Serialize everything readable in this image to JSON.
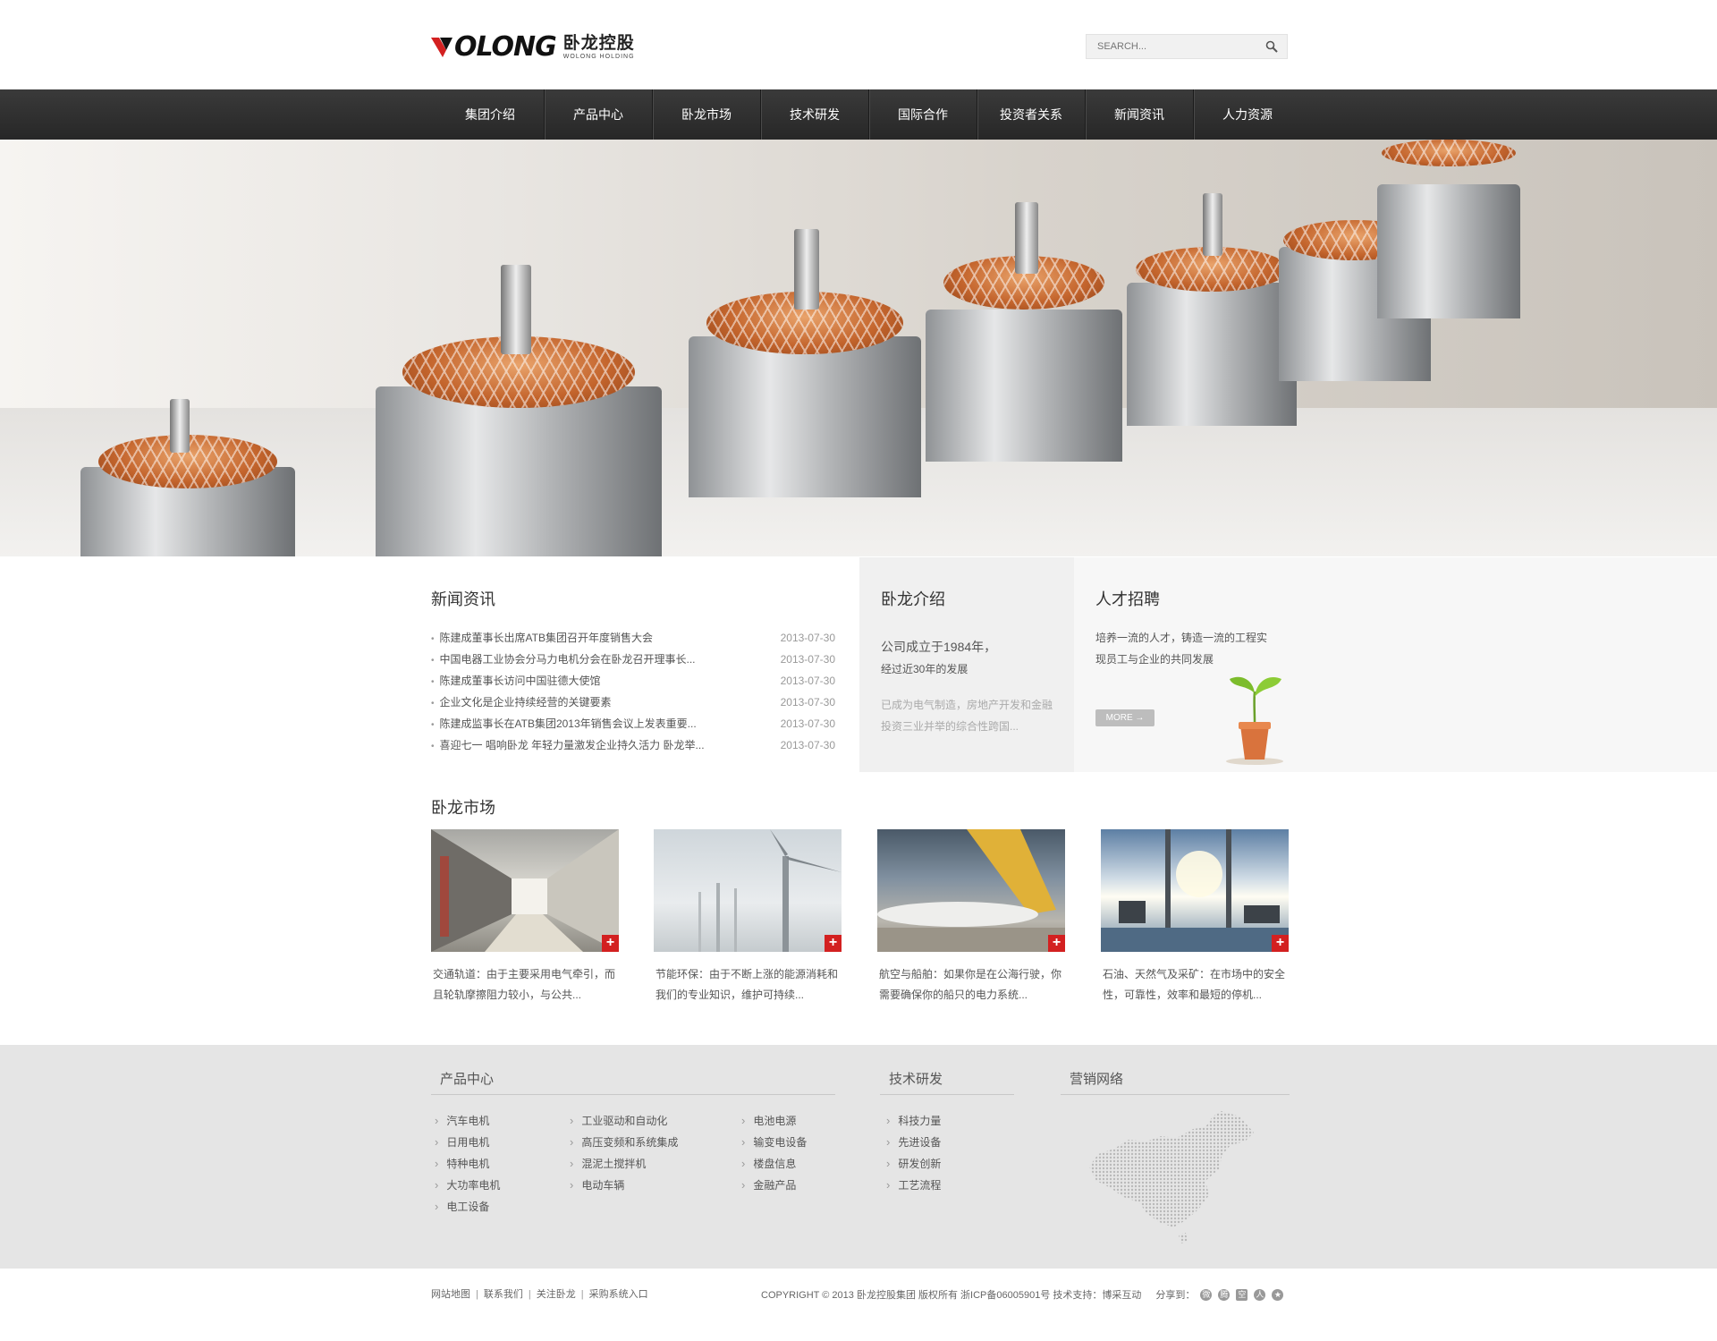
{
  "header": {
    "logo_text": "OLONG",
    "logo_cn": "卧龙控股",
    "logo_en": "WOLONG HOLDING",
    "search_placeholder": "SEARCH..."
  },
  "nav": [
    "集团介绍",
    "产品中心",
    "卧龙市场",
    "技术研发",
    "国际合作",
    "投资者关系",
    "新闻资讯",
    "人力资源"
  ],
  "news": {
    "title": "新闻资讯",
    "items": [
      {
        "text": "陈建成董事长出席ATB集团召开年度销售大会",
        "date": "2013-07-30"
      },
      {
        "text": "中国电器工业协会分马力电机分会在卧龙召开理事长...",
        "date": "2013-07-30"
      },
      {
        "text": "陈建成董事长访问中国驻德大使馆",
        "date": "2013-07-30"
      },
      {
        "text": "企业文化是企业持续经营的关键要素",
        "date": "2013-07-30"
      },
      {
        "text": "陈建成监事长在ATB集团2013年销售会议上发表重要...",
        "date": "2013-07-30"
      },
      {
        "text": "喜迎七一 唱响卧龙 年轻力量激发企业持久活力 卧龙举...",
        "date": "2013-07-30"
      }
    ]
  },
  "about": {
    "title": "卧龙介绍",
    "line1": "公司成立于1984年，",
    "line2": "经过近30年的发展",
    "line3": "已成为电气制造，房地产开发和金融投资三业并举的综合性跨国..."
  },
  "recruit": {
    "title": "人才招聘",
    "text": "培养一流的人才，铸造一流的工程实现员工与企业的共同发展",
    "more": "MORE →"
  },
  "market": {
    "title": "卧龙市场",
    "cards": [
      {
        "desc": "交通轨道：由于主要采用电气牵引，而且轮轨摩擦阻力较小，与公共..."
      },
      {
        "desc": "节能环保：由于不断上涨的能源消耗和我们的专业知识，维护可持续..."
      },
      {
        "desc": "航空与船舶：如果你是在公海行驶，你需要确保你的船只的电力系统..."
      },
      {
        "desc": "石油、天然气及采矿：在市场中的安全性，可靠性，效率和最短的停机..."
      }
    ],
    "plus": "+"
  },
  "footer": {
    "products_title": "产品中心",
    "products_col1": [
      "汽车电机",
      "日用电机",
      "特种电机",
      "大功率电机",
      "电工设备"
    ],
    "products_col2": [
      "工业驱动和自动化",
      "高压变频和系统集成",
      "混泥土搅拌机",
      "电动车辆"
    ],
    "products_col3": [
      "电池电源",
      "输变电设备",
      "楼盘信息",
      "金融产品"
    ],
    "tech_title": "技术研发",
    "tech_items": [
      "科技力量",
      "先进设备",
      "研发创新",
      "工艺流程"
    ],
    "network_title": "营销网络"
  },
  "bottom": {
    "links": [
      "网站地图",
      "联系我们",
      "关注卧龙",
      "采购系统入口"
    ],
    "copyright": "COPYRIGHT © 2013 卧龙控股集团 版权所有 浙ICP备06005901号 技术支持：博采互动",
    "share_label": "分享到："
  },
  "colors": {
    "accent": "#d32020",
    "nav": "#2f2f2f",
    "footer": "#e5e5e5"
  }
}
